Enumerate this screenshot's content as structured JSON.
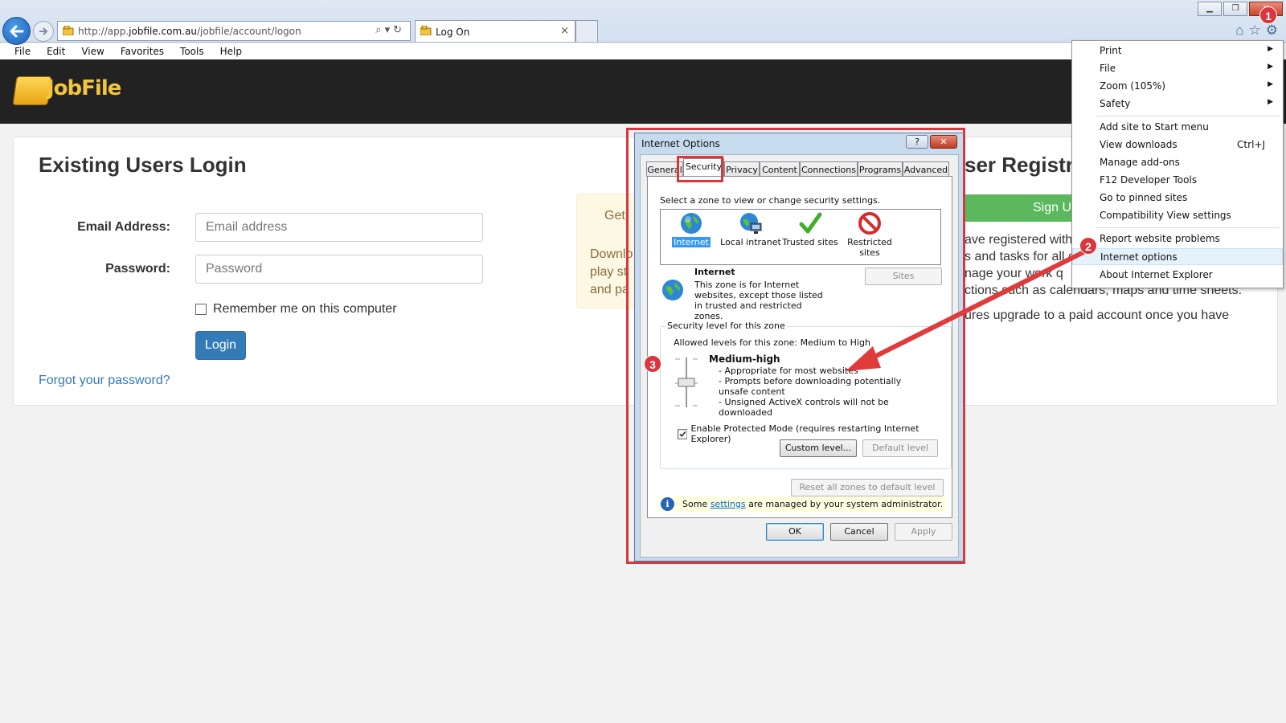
{
  "browser": {
    "address_prefix": "http://app.",
    "address_domain": "jobfile.com.au",
    "address_path": "/jobfile/account/logon",
    "tab_title": "Log On",
    "tab_close": "×",
    "menubar": [
      "File",
      "Edit",
      "View",
      "Favorites",
      "Tools",
      "Help"
    ]
  },
  "site": {
    "logo_text": "JobFile"
  },
  "login": {
    "title": "Existing Users Login",
    "email_label": "Email Address:",
    "email_placeholder": "Email address",
    "password_label": "Password:",
    "password_placeholder": "Password",
    "remember_label": "Remember me on this computer",
    "login_button": "Login",
    "forgot_link": "Forgot your password?"
  },
  "promo": {
    "line1": "Get",
    "lines": [
      "Downlo",
      "play st",
      "and pa"
    ]
  },
  "registration": {
    "title_fragment": "ser Registra",
    "signup_fragment": "Sign U",
    "text_lines": [
      "ave registered with",
      "s and tasks for all c",
      "nage your work q",
      "ctions such as calendars, maps and time sheets.",
      "ures  upgrade  to  a  paid  account  once  you  have"
    ]
  },
  "tools_menu": {
    "items": [
      {
        "label": "Print",
        "submenu": true
      },
      {
        "label": "File",
        "submenu": true
      },
      {
        "label": "Zoom (105%)",
        "submenu": true
      },
      {
        "label": "Safety",
        "submenu": true
      },
      {
        "label": "Add site to Start menu"
      },
      {
        "label": "View downloads",
        "shortcut": "Ctrl+J"
      },
      {
        "label": "Manage add-ons"
      },
      {
        "label": "F12 Developer Tools"
      },
      {
        "label": "Go to pinned sites"
      },
      {
        "label": "Compatibility View settings"
      },
      {
        "label": "Report website problems"
      },
      {
        "label": "Internet options",
        "highlighted": true
      },
      {
        "label": "About Internet Explorer"
      }
    ]
  },
  "dialog": {
    "title": "Internet Options",
    "help": "?",
    "close": "✕",
    "tabs": [
      "General",
      "Security",
      "Privacy",
      "Content",
      "Connections",
      "Programs",
      "Advanced"
    ],
    "active_tab": "Security",
    "zone_prompt": "Select a zone to view or change security settings.",
    "zones": [
      "Internet",
      "Local intranet",
      "Trusted sites",
      "Restricted sites"
    ],
    "selected_zone": "Internet",
    "zone_name": "Internet",
    "zone_desc": "This zone is for Internet websites, except those listed in trusted and restricted zones.",
    "sites_button": "Sites",
    "level_group": "Security level for this zone",
    "allowed_levels": "Allowed levels for this zone: Medium to High",
    "level_name": "Medium-high",
    "level_points": [
      "- Appropriate for most websites",
      "- Prompts before downloading potentially unsafe content",
      "- Unsigned ActiveX controls will not be downloaded"
    ],
    "protected_mode_label": "Enable Protected Mode (requires restarting Internet Explorer)",
    "protected_mode_checked": true,
    "custom_level_button": "Custom level...",
    "default_level_button": "Default level",
    "reset_button": "Reset all zones to default level",
    "info_before": "Some ",
    "info_link": "settings",
    "info_after": " are managed by your system administrator.",
    "ok_button": "OK",
    "cancel_button": "Cancel",
    "apply_button": "Apply"
  },
  "annotations": {
    "badges": [
      "1",
      "2",
      "3"
    ],
    "color": "#d9363e"
  }
}
